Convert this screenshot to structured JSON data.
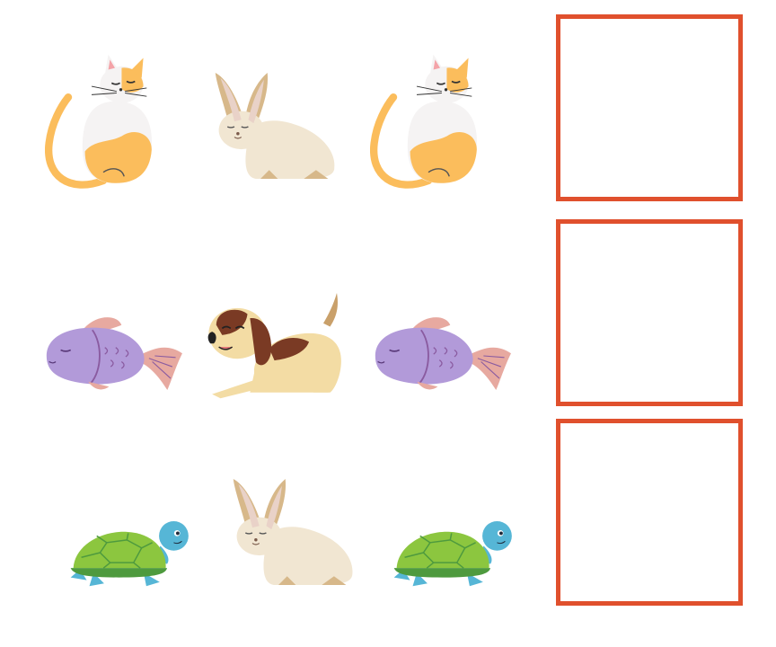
{
  "worksheet": {
    "rows": [
      {
        "sequence": [
          "cat-icon",
          "rabbit-icon",
          "cat-icon"
        ],
        "answer": ""
      },
      {
        "sequence": [
          "fish-icon",
          "dog-icon",
          "fish-icon"
        ],
        "answer": ""
      },
      {
        "sequence": [
          "turtle-icon",
          "rabbit-icon",
          "turtle-icon"
        ],
        "answer": ""
      }
    ],
    "colors": {
      "answer_box_border": "#e0502d",
      "cat_body": "#f5f3f3",
      "cat_patch": "#fbbd5c",
      "rabbit_body": "#f1e6d2",
      "rabbit_ear": "#d7b88a",
      "fish_body": "#b29ad9",
      "fish_fin": "#e7a9a0",
      "dog_body": "#f3dca4",
      "dog_ear": "#7a3a24",
      "turtle_shell": "#8cc63f",
      "turtle_skin": "#56b6d6"
    }
  }
}
